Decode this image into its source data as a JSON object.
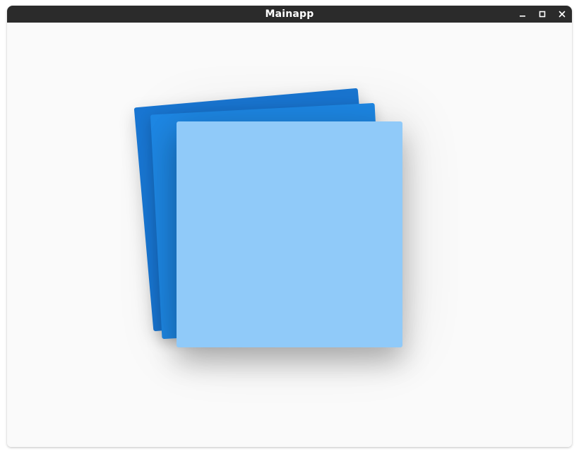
{
  "window": {
    "title": "Mainapp",
    "controls": [
      {
        "name": "minimize",
        "icon": "minimize-icon"
      },
      {
        "name": "maximize",
        "icon": "maximize-icon"
      },
      {
        "name": "close",
        "icon": "close-icon"
      }
    ]
  },
  "colors": {
    "titlebar": "#2b2b2b",
    "title_text": "#ffffff",
    "content_bg": "#fafafa",
    "card_back": "#1976d2",
    "card_middle": "#1e88e5",
    "card_front": "#90caf9"
  },
  "cards": [
    {
      "name": "card-back",
      "color": "#1976d2",
      "rotation_deg": -5
    },
    {
      "name": "card-middle",
      "color": "#1e88e5",
      "rotation_deg": -3
    },
    {
      "name": "card-front",
      "color": "#90caf9",
      "rotation_deg": 0
    }
  ]
}
